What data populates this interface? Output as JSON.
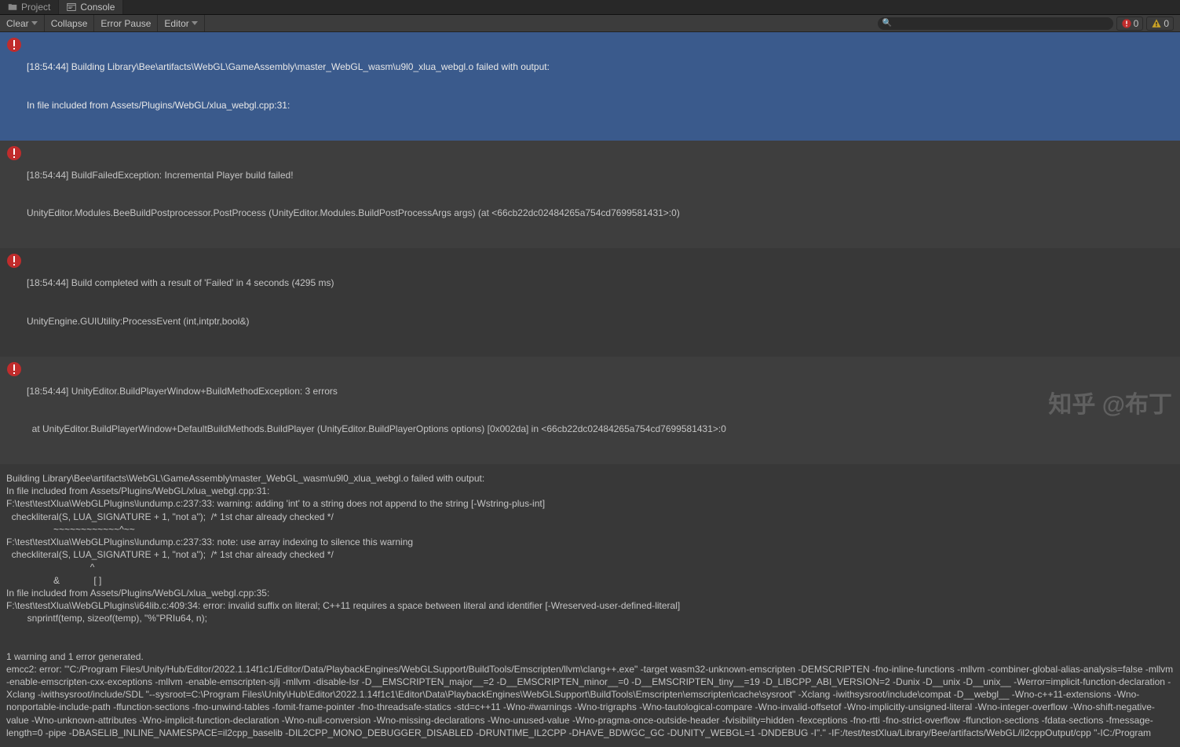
{
  "tabs": {
    "project": "Project",
    "console": "Console"
  },
  "toolbar": {
    "clear": "Clear",
    "collapse": "Collapse",
    "error_pause": "Error Pause",
    "editor": "Editor"
  },
  "counts": {
    "errors": "0",
    "warnings": "0"
  },
  "entries": [
    {
      "line1": "[18:54:44] Building Library\\Bee\\artifacts\\WebGL\\GameAssembly\\master_WebGL_wasm\\u9l0_xlua_webgl.o failed with output:",
      "line2": "In file included from Assets/Plugins/WebGL/xlua_webgl.cpp:31:"
    },
    {
      "line1": "[18:54:44] BuildFailedException: Incremental Player build failed!",
      "line2": "UnityEditor.Modules.BeeBuildPostprocessor.PostProcess (UnityEditor.Modules.BuildPostProcessArgs args) (at <66cb22dc02484265a754cd7699581431>:0)"
    },
    {
      "line1": "[18:54:44] Build completed with a result of 'Failed' in 4 seconds (4295 ms)",
      "line2": "UnityEngine.GUIUtility:ProcessEvent (int,intptr,bool&)"
    },
    {
      "line1": "[18:54:44] UnityEditor.BuildPlayerWindow+BuildMethodException: 3 errors",
      "line2": "  at UnityEditor.BuildPlayerWindow+DefaultBuildMethods.BuildPlayer (UnityEditor.BuildPlayerOptions options) [0x002da] in <66cb22dc02484265a754cd7699581431>:0"
    }
  ],
  "detail": "Building Library\\Bee\\artifacts\\WebGL\\GameAssembly\\master_WebGL_wasm\\u9l0_xlua_webgl.o failed with output:\nIn file included from Assets/Plugins/WebGL/xlua_webgl.cpp:31:\nF:\\test\\testXlua\\WebGLPlugins\\lundump.c:237:33: warning: adding 'int' to a string does not append to the string [-Wstring-plus-int]\n  checkliteral(S, LUA_SIGNATURE + 1, \"not a\");  /* 1st char already checked */\n                  ~~~~~~~~~~~~^~~\nF:\\test\\testXlua\\WebGLPlugins\\lundump.c:237:33: note: use array indexing to silence this warning\n  checkliteral(S, LUA_SIGNATURE + 1, \"not a\");  /* 1st char already checked */\n                                ^\n                  &             [ ]\nIn file included from Assets/Plugins/WebGL/xlua_webgl.cpp:35:\nF:\\test\\testXlua\\WebGLPlugins\\i64lib.c:409:34: error: invalid suffix on literal; C++11 requires a space between literal and identifier [-Wreserved-user-defined-literal]\n        snprintf(temp, sizeof(temp), \"%\"PRIu64, n);\n\n\n1 warning and 1 error generated.\nemcc2: error: '\"C:/Program Files/Unity/Hub/Editor/2022.1.14f1c1/Editor/Data/PlaybackEngines/WebGLSupport/BuildTools/Emscripten/llvm\\clang++.exe\" -target wasm32-unknown-emscripten -DEMSCRIPTEN -fno-inline-functions -mllvm -combiner-global-alias-analysis=false -mllvm -enable-emscripten-cxx-exceptions -mllvm -enable-emscripten-sjlj -mllvm -disable-lsr -D__EMSCRIPTEN_major__=2 -D__EMSCRIPTEN_minor__=0 -D__EMSCRIPTEN_tiny__=19 -D_LIBCPP_ABI_VERSION=2 -Dunix -D__unix -D__unix__ -Werror=implicit-function-declaration -Xclang -iwithsysroot/include/SDL \"--sysroot=C:\\Program Files\\Unity\\Hub\\Editor\\2022.1.14f1c1\\Editor\\Data\\PlaybackEngines\\WebGLSupport\\BuildTools\\Emscripten\\emscripten\\cache\\sysroot\" -Xclang -iwithsysroot/include\\compat -D__webgl__ -Wno-c++11-extensions -Wno-nonportable-include-path -ffunction-sections -fno-unwind-tables -fomit-frame-pointer -fno-threadsafe-statics -std=c++11 -Wno-#warnings -Wno-trigraphs -Wno-tautological-compare -Wno-invalid-offsetof -Wno-implicitly-unsigned-literal -Wno-integer-overflow -Wno-shift-negative-value -Wno-unknown-attributes -Wno-implicit-function-declaration -Wno-null-conversion -Wno-missing-declarations -Wno-unused-value -Wno-pragma-once-outside-header -fvisibility=hidden -fexceptions -fno-rtti -fno-strict-overflow -ffunction-sections -fdata-sections -fmessage-length=0 -pipe -DBASELIB_INLINE_NAMESPACE=il2cpp_baselib -DIL2CPP_MONO_DEBUGGER_DISABLED -DRUNTIME_IL2CPP -DHAVE_BDWGC_GC -DUNITY_WEBGL=1 -DNDEBUG -I\".\" -IF:/test/testXlua/Library/Bee/artifacts/WebGL/il2cppOutput/cpp \"-IC:/Program",
  "watermark": "知乎 @布丁"
}
